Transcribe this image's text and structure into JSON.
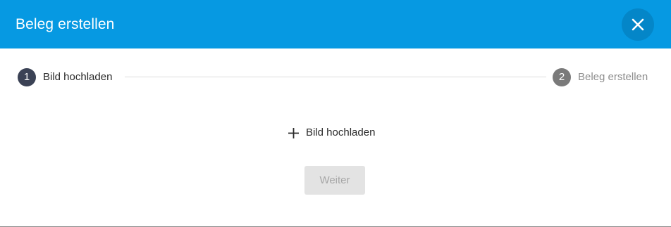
{
  "dialog": {
    "title": "Beleg erstellen",
    "close_icon": "close-icon"
  },
  "stepper": {
    "steps": [
      {
        "number": "1",
        "label": "Bild hochladen",
        "state": "active"
      },
      {
        "number": "2",
        "label": "Beleg erstellen",
        "state": "inactive"
      }
    ]
  },
  "upload": {
    "icon": "plus-icon",
    "label": "Bild hochladen"
  },
  "actions": {
    "next_label": "Weiter",
    "next_disabled": true
  },
  "colors": {
    "header": "#0699e2",
    "close_button": "#0486c8",
    "step_active": "#3b4255",
    "step_inactive": "#7a7a7a",
    "button_disabled_bg": "#e3e3e3",
    "button_disabled_text": "#a6a6a6"
  }
}
